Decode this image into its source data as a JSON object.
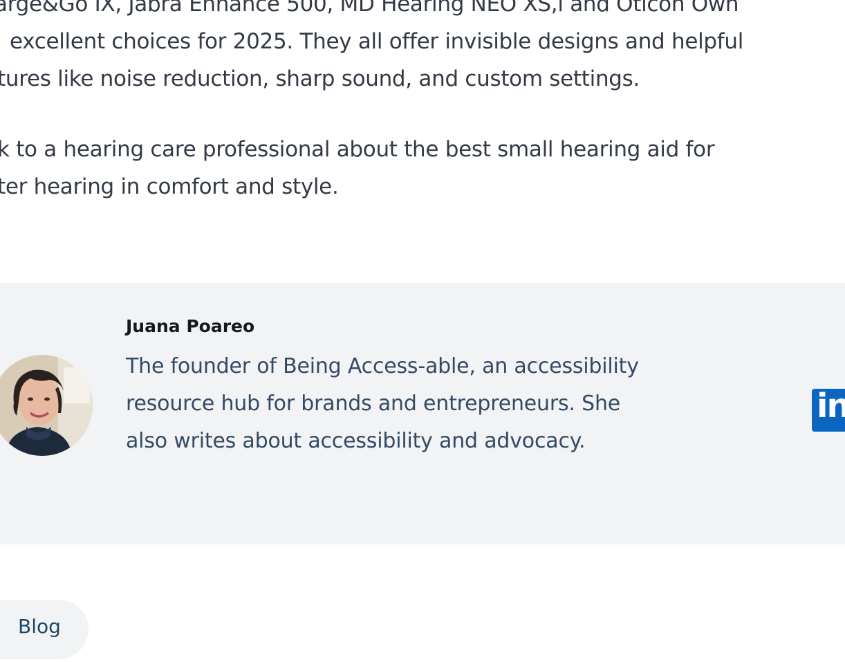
{
  "article": {
    "lines": [
      "arge&Go IX, Jabra Enhance 500, MD Hearing NEO XS,l and Oticon Own",
      "excellent choices for 2025. They all offer invisible designs and helpful",
      "tures like noise reduction, sharp sound, and custom settings.",
      "k to a hearing care professional about the best small hearing aid for",
      "ter hearing in comfort and style."
    ]
  },
  "author": {
    "name": "Juana Poareo",
    "bio_lines": [
      "The founder of Being Access-able, an accessibility",
      "resource hub for brands and entrepreneurs. She",
      "also writes about accessibility and advocacy."
    ],
    "social_icon": "linkedin-icon",
    "social_label": "in"
  },
  "tags": {
    "blog_label": "Blog"
  },
  "colors": {
    "author_box_bg": "#f2f3f5",
    "linkedin_blue": "#0a66c2",
    "tag_text": "#19466b"
  }
}
